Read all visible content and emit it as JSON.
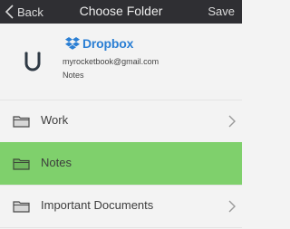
{
  "navbar": {
    "back_label": "Back",
    "title": "Choose Folder",
    "save_label": "Save"
  },
  "account": {
    "provider": "Dropbox",
    "email": "myrocketbook@gmail.com",
    "folder": "Notes"
  },
  "folders": [
    {
      "label": "Work",
      "selected": false,
      "has_chevron": true
    },
    {
      "label": "Notes",
      "selected": true,
      "has_chevron": false
    },
    {
      "label": "Important Documents",
      "selected": false,
      "has_chevron": true
    }
  ],
  "colors": {
    "navbar_bg": "#2f2f33",
    "selected_row": "#7fd06c",
    "dropbox_blue": "#2b7fd4",
    "background": "#f3f3f3"
  },
  "icons": {
    "back": "chevron-left-icon",
    "provider": "dropbox-logo-icon",
    "avatar": "horseshoe-icon",
    "folder": "folder-icon",
    "row_chevron": "chevron-right-icon"
  }
}
